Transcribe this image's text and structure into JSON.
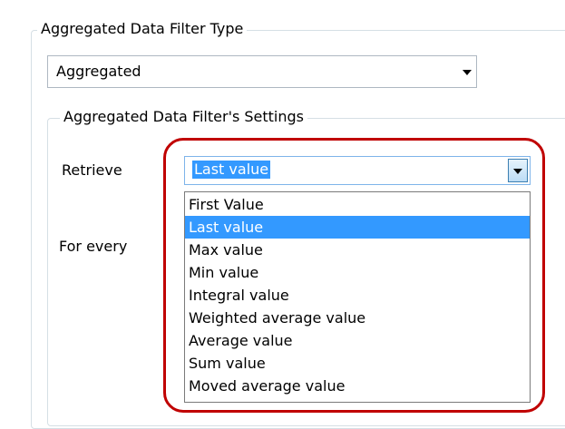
{
  "filter_type": {
    "group_title": "Aggregated Data Filter Type",
    "selected": "Aggregated"
  },
  "settings": {
    "group_title": "Aggregated Data Filter's Settings",
    "retrieve_label": "Retrieve",
    "retrieve_value": "Last value",
    "for_every_label": "For every"
  },
  "dropdown": {
    "options": [
      "First Value",
      "Last value",
      "Max value",
      "Min value",
      "Integral value",
      "Weighted average value",
      "Average value",
      "Sum value",
      "Moved average value"
    ],
    "selected_index": 1
  },
  "colors": {
    "selection": "#3399ff",
    "annotation_ring": "#c00000",
    "group_border": "#d5dfe5"
  }
}
